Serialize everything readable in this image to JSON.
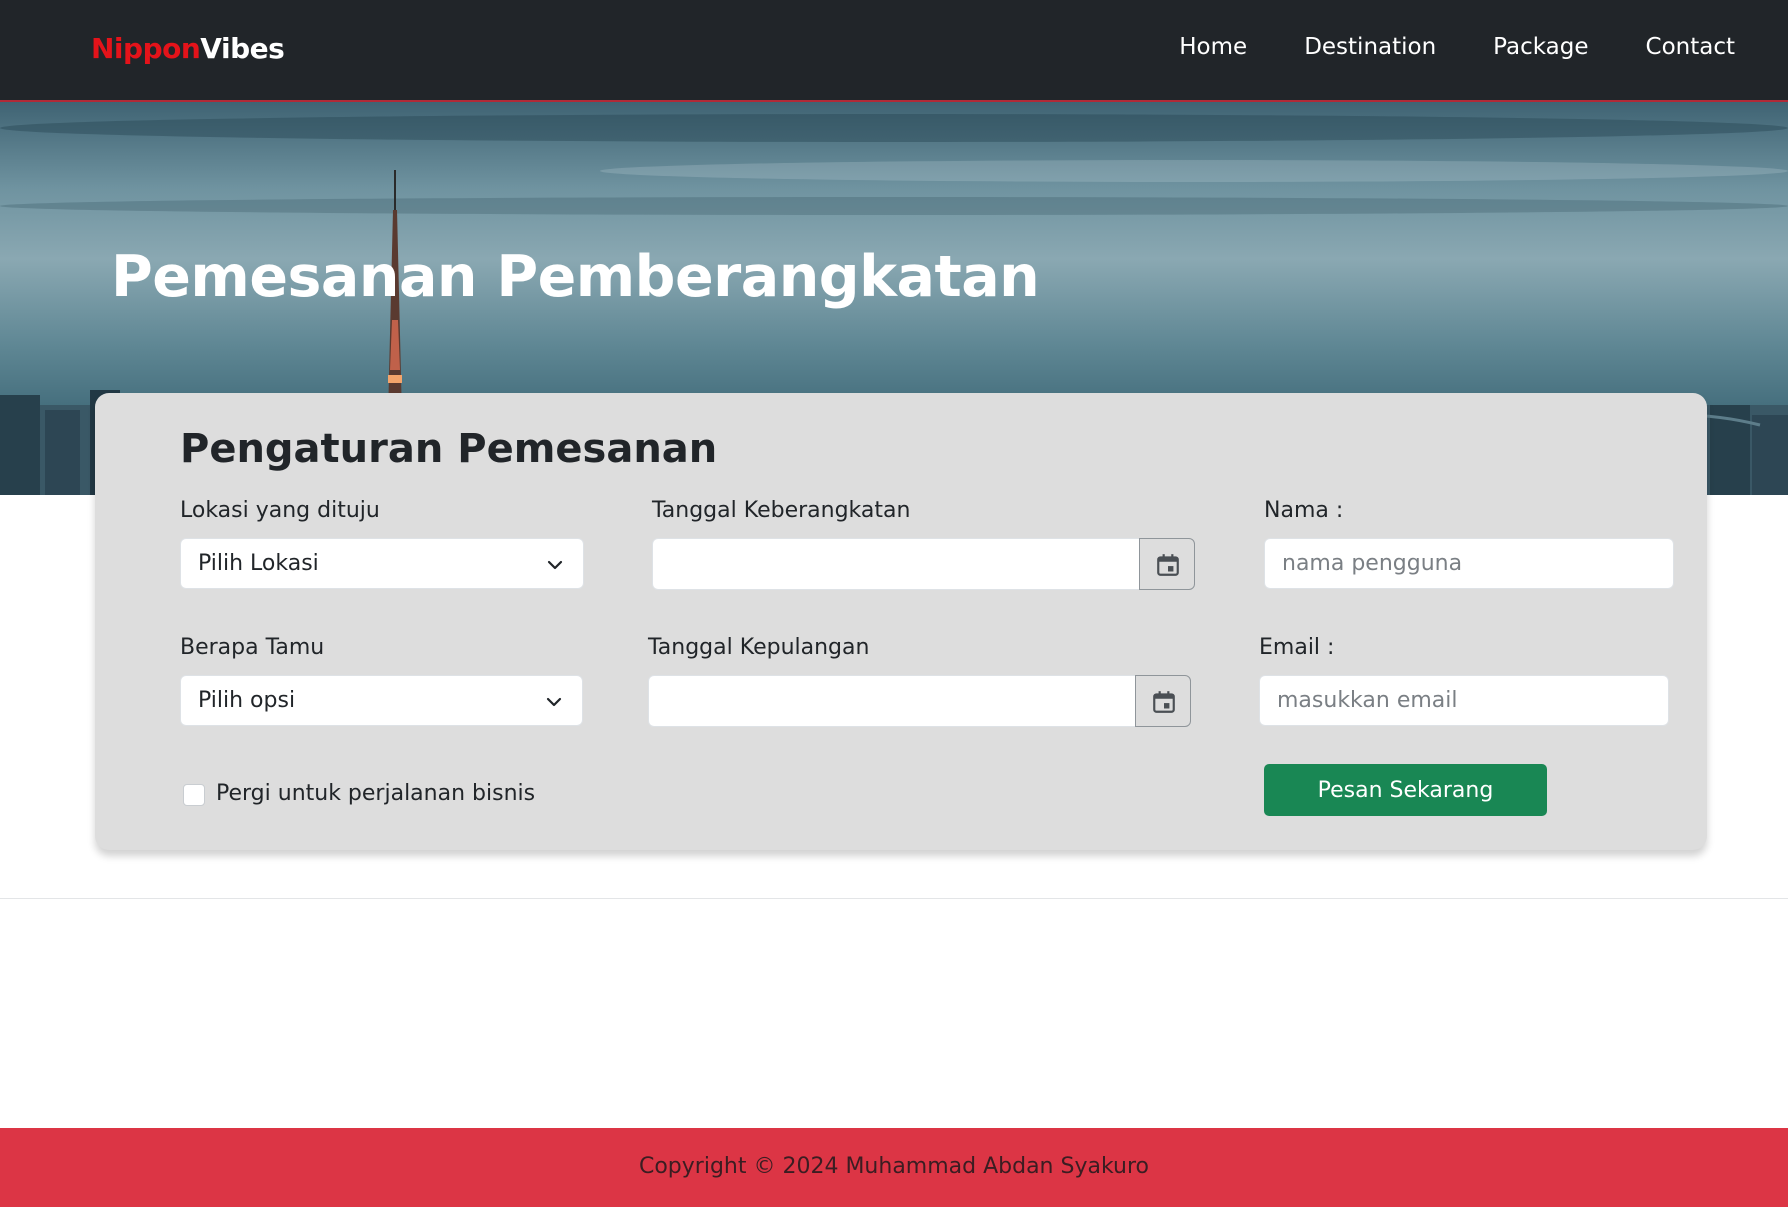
{
  "brand": {
    "part1": "Nippon",
    "part2": "Vibes",
    "color_red": "#e4131a"
  },
  "nav": {
    "items": [
      {
        "label": "Home"
      },
      {
        "label": "Destination"
      },
      {
        "label": "Package"
      },
      {
        "label": "Contact"
      }
    ]
  },
  "hero": {
    "title": "Pemesanan Pemberangkatan"
  },
  "form": {
    "title": "Pengaturan Pemesanan",
    "location": {
      "label": "Lokasi yang dituju",
      "selected": "Pilih Lokasi"
    },
    "departure_date": {
      "label": "Tanggal Keberangkatan",
      "value": "",
      "icon": "calendar-icon"
    },
    "name": {
      "label": "Nama :",
      "placeholder": "nama pengguna",
      "value": ""
    },
    "guests": {
      "label": "Berapa Tamu",
      "selected": "Pilih opsi"
    },
    "return_date": {
      "label": "Tanggal Kepulangan",
      "value": "",
      "icon": "calendar-icon"
    },
    "email": {
      "label": "Email :",
      "placeholder": "masukkan email",
      "value": ""
    },
    "business_trip": {
      "label": "Pergi untuk perjalanan bisnis",
      "checked": false
    },
    "submit_label": "Pesan Sekarang"
  },
  "footer": {
    "text": "Copyright © 2024 Muhammad Abdan Syakuro"
  },
  "colors": {
    "navbar": "#212529",
    "accent_green": "#198754",
    "footer_red": "#dc3545",
    "card_bg": "#dddddd"
  }
}
